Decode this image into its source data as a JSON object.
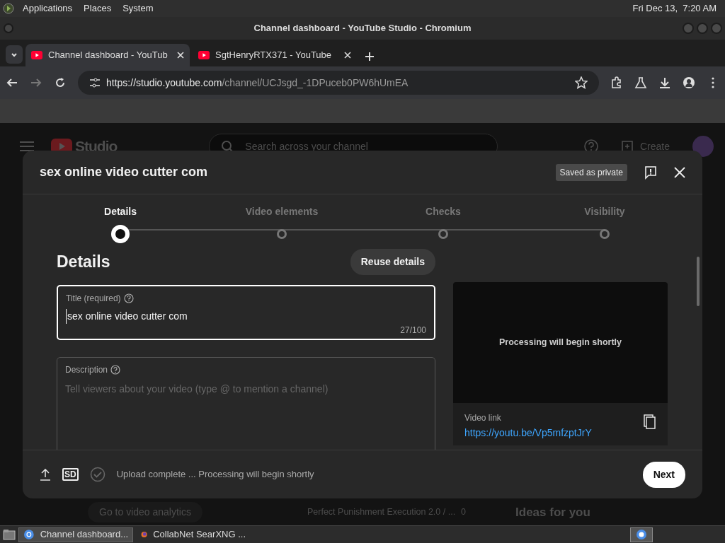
{
  "desktop_panel": {
    "menus": [
      "Applications",
      "Places",
      "System"
    ],
    "clock": "Fri Dec 13,  7:20 AM"
  },
  "window": {
    "title": "Channel dashboard - YouTube Studio - Chromium"
  },
  "tabs": [
    {
      "label": "Channel dashboard - YouTub",
      "selected": true
    },
    {
      "label": "SgtHenryRTX371 - YouTube",
      "selected": false
    }
  ],
  "address_bar": {
    "host": "https://studio.youtube.com",
    "path": "/channel/UCJsgd_-1DPuceb0PW6hUmEA"
  },
  "studio_header": {
    "logo": "Studio",
    "search_placeholder": "Search across your channel",
    "create": "Create"
  },
  "background": {
    "button": "Go to video analytics",
    "video_title": "Perfect Punishment Execution 2.0 / ...",
    "count": "0",
    "heading": "Ideas for you"
  },
  "dialog": {
    "title": "sex online video cutter com",
    "status_badge": "Saved as private",
    "steps": [
      {
        "label": "Details",
        "selected": true
      },
      {
        "label": "Video elements",
        "selected": false
      },
      {
        "label": "Checks",
        "selected": false
      },
      {
        "label": "Visibility",
        "selected": false
      }
    ],
    "section_heading": "Details",
    "reuse_button": "Reuse details",
    "title_field": {
      "label": "Title (required)",
      "value": "sex online video cutter com",
      "counter": "27/100"
    },
    "description_field": {
      "label": "Description",
      "placeholder": "Tell viewers about your video (type @ to mention a channel)"
    },
    "preview": {
      "message": "Processing will begin shortly",
      "link_label": "Video link",
      "link": "https://youtu.be/Vp5mfzptJrY"
    },
    "footer": {
      "quality_badge": "SD",
      "status": "Upload complete ... Processing will begin shortly",
      "next_button": "Next"
    }
  },
  "taskbar": [
    {
      "label": "Channel dashboard...",
      "selected": true
    },
    {
      "label": "CollabNet SearXNG ...",
      "selected": false
    }
  ]
}
